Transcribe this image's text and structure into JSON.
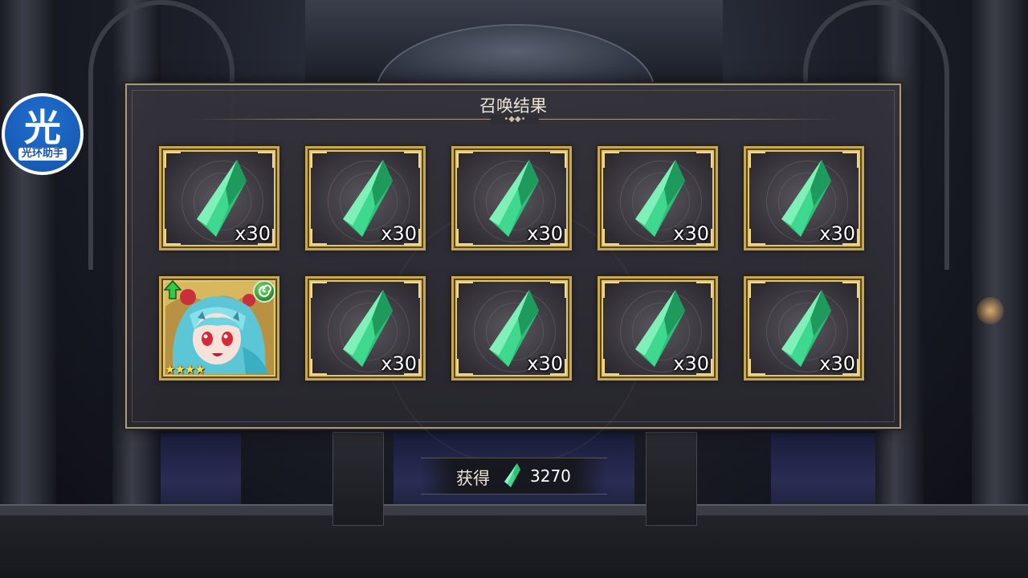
{
  "watermark": {
    "glyph": "光",
    "label": "光环助手"
  },
  "panel": {
    "title": "召唤结果",
    "divider_ornament": "•◆◆•"
  },
  "rewards": [
    {
      "type": "crystal",
      "quantity": "x30"
    },
    {
      "type": "crystal",
      "quantity": "x30"
    },
    {
      "type": "crystal",
      "quantity": "x30"
    },
    {
      "type": "crystal",
      "quantity": "x30"
    },
    {
      "type": "crystal",
      "quantity": "x30"
    },
    {
      "type": "character",
      "rarity": 4,
      "stars": "★★★★",
      "element": "wind",
      "upgrade": true
    },
    {
      "type": "crystal",
      "quantity": "x30"
    },
    {
      "type": "crystal",
      "quantity": "x30"
    },
    {
      "type": "crystal",
      "quantity": "x30"
    },
    {
      "type": "crystal",
      "quantity": "x30"
    }
  ],
  "obtain": {
    "label": "获得",
    "icon": "crystal-icon",
    "amount": "3270"
  },
  "colors": {
    "crystal": "#3ddc8e",
    "frame_gold": "#c7a74f",
    "panel_border": "#a99a82"
  }
}
